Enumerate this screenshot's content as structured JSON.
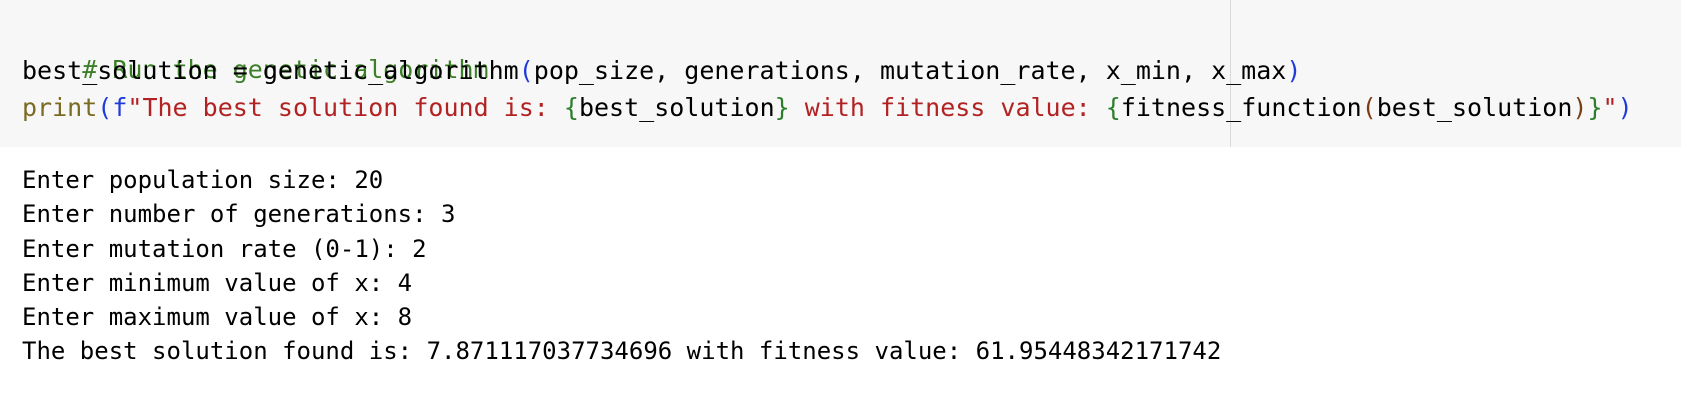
{
  "code": {
    "comment": "# Run the genetic algorithm",
    "line2": {
      "prefix": "best_solution = genetic_algorithm",
      "open": "(",
      "args": "pop_size, generations, mutation_rate, x_min, x_max",
      "close": ")"
    },
    "line3": {
      "func": "print",
      "open": "(",
      "fprefix": "f",
      "str1": "\"The best solution found is: ",
      "brace1_open": "{",
      "expr1": "best_solution",
      "brace1_close": "}",
      "str2": " with fitness value: ",
      "brace2_open": "{",
      "expr2_func": "fitness_function",
      "expr2_open": "(",
      "expr2_arg": "best_solution",
      "expr2_close": ")",
      "brace2_close": "}",
      "str_end": "\"",
      "close": ")"
    }
  },
  "output": {
    "lines": [
      "Enter population size: 20",
      "Enter number of generations: 3",
      "Enter mutation rate (0-1): 2",
      "Enter minimum value of x: 4",
      "Enter maximum value of x: 8",
      "The best solution found is: 7.871117037734696 with fitness value: 61.95448342171742"
    ]
  },
  "colors": {
    "cell_background": "#f7f7f7",
    "comment": "#3d7f28",
    "builtin": "#7a6b22",
    "string": "#b22222",
    "bracket_level1": "#1f3cdb",
    "bracket_level2": "#2c7d2c",
    "bracket_level3": "#7a3e16"
  }
}
